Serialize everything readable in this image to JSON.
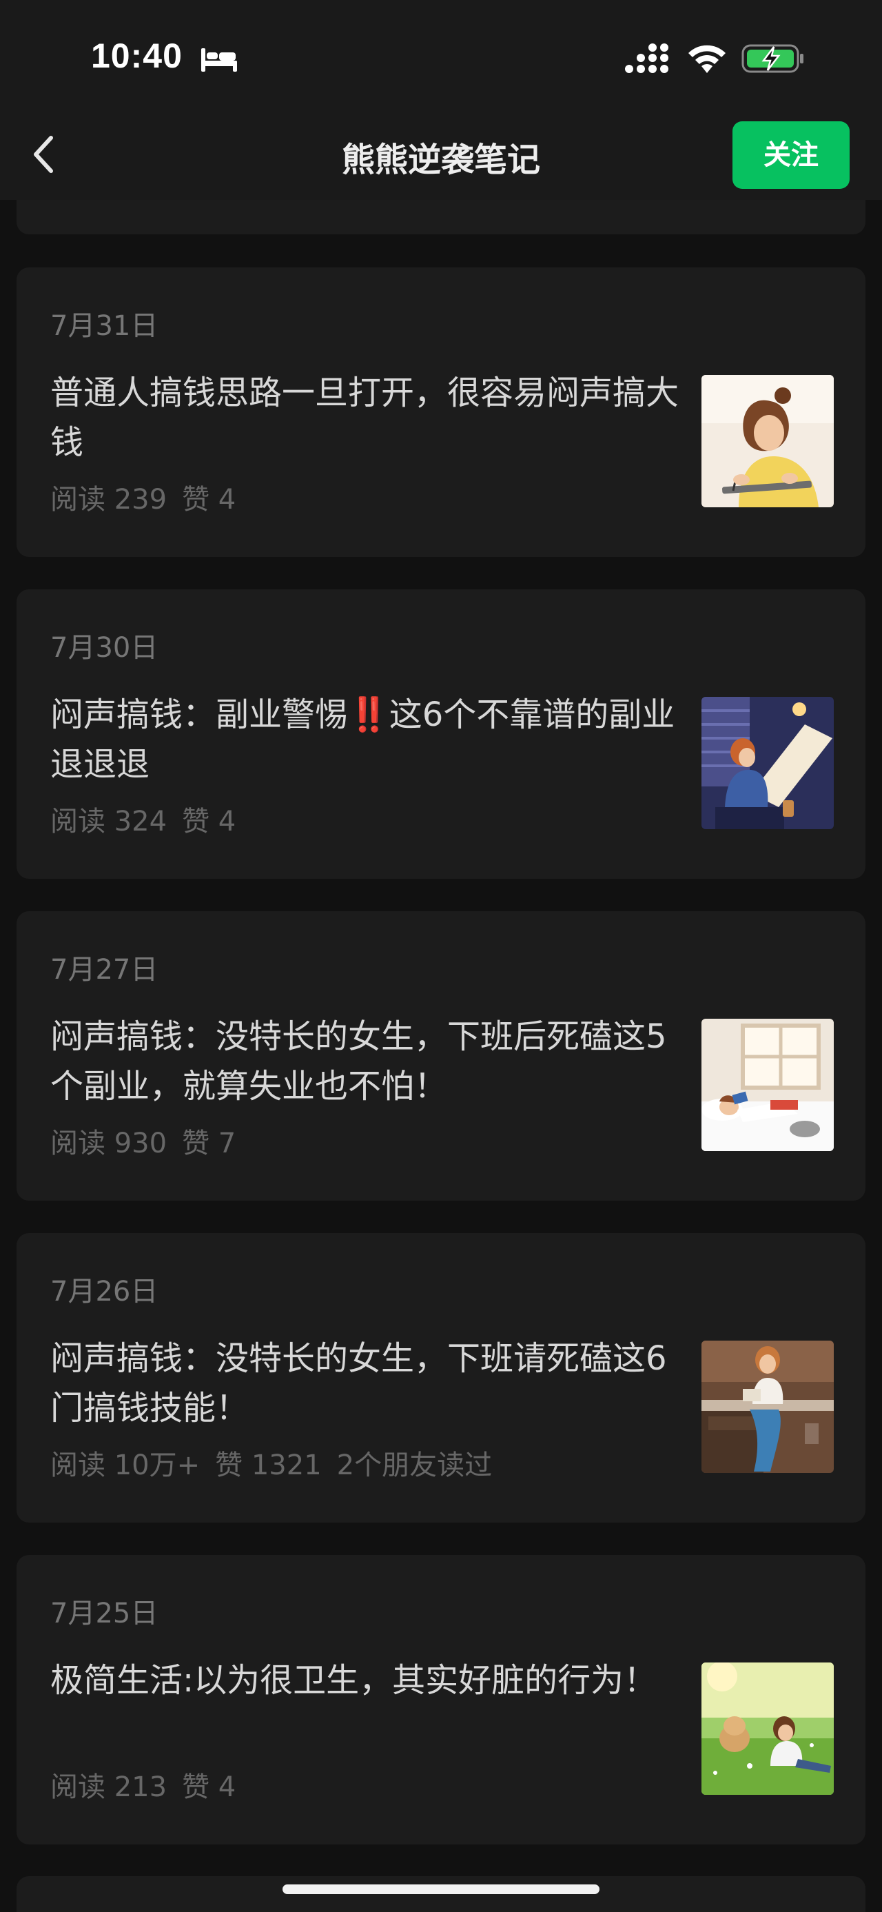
{
  "status_bar": {
    "time": "10:40",
    "icons": [
      "bed-icon",
      "signal-icon",
      "wifi-icon",
      "battery-charging-icon"
    ]
  },
  "header": {
    "title": "熊熊逆袭笔记",
    "follow_label": "关注",
    "back_icon": "chevron-left-icon"
  },
  "colors": {
    "accent": "#07c160",
    "background": "#111111",
    "card": "#1c1c1c"
  },
  "articles": [
    {
      "date": "7月31日",
      "title": "普通人搞钱思路一旦打开，很容易闷声搞大钱",
      "reads": "阅读 239",
      "likes": "赞 4",
      "friends": ""
    },
    {
      "date": "7月30日",
      "title": "闷声搞钱：副业警惕‼️这6个不靠谱的副业退退退",
      "reads": "阅读 324",
      "likes": "赞 4",
      "friends": ""
    },
    {
      "date": "7月27日",
      "title": "闷声搞钱：没特长的女生，下班后死磕这5个副业，就算失业也不怕！",
      "reads": "阅读 930",
      "likes": "赞 7",
      "friends": ""
    },
    {
      "date": "7月26日",
      "title": "闷声搞钱：没特长的女生，下班请死磕这6门搞钱技能！",
      "reads": "阅读 10万+",
      "likes": "赞 1321",
      "friends": "2个朋友读过"
    },
    {
      "date": "7月25日",
      "title": "极简生活:以为很卫生，其实好脏的行为！",
      "reads": "阅读 213",
      "likes": "赞 4",
      "friends": ""
    }
  ]
}
